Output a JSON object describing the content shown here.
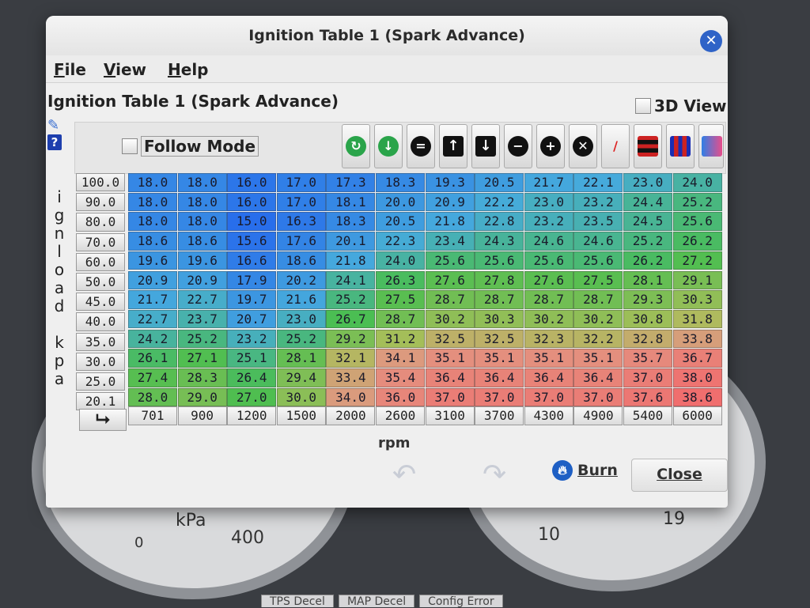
{
  "window": {
    "title": "Ignition Table 1 (Spark Advance)"
  },
  "menu": [
    "File",
    "View",
    "Help"
  ],
  "table_heading": "Ignition Table 1 (Spark Advance)",
  "view3d_label": "3D View",
  "follow_mode_label": "Follow Mode",
  "toolbar_icons": [
    "rotate-up-icon",
    "rotate-down-icon",
    "equals-icon",
    "arrow-up-icon",
    "arrow-down-icon",
    "minus-icon",
    "plus-icon",
    "multiply-icon",
    "pencil-icon",
    "rows-icon",
    "columns-icon",
    "color-gradient-icon"
  ],
  "y_axis": {
    "label": "i g n l o a d   k p a",
    "chars": [
      "i",
      "g",
      "n",
      "l",
      "o",
      "a",
      "d",
      "",
      "k",
      "p",
      "a"
    ],
    "values": [
      "100.0",
      "90.0",
      "80.0",
      "70.0",
      "60.0",
      "50.0",
      "45.0",
      "40.0",
      "35.0",
      "30.0",
      "25.0",
      "20.1"
    ]
  },
  "x_axis": {
    "label": "rpm",
    "values": [
      "701",
      "900",
      "1200",
      "1500",
      "2000",
      "2600",
      "3100",
      "3700",
      "4300",
      "4900",
      "5400",
      "6000"
    ]
  },
  "grid": [
    [
      "18.0",
      "18.0",
      "16.0",
      "17.0",
      "17.3",
      "18.3",
      "19.3",
      "20.5",
      "21.7",
      "22.1",
      "23.0",
      "24.0"
    ],
    [
      "18.0",
      "18.0",
      "16.0",
      "17.0",
      "18.1",
      "20.0",
      "20.9",
      "22.2",
      "23.0",
      "23.2",
      "24.4",
      "25.2"
    ],
    [
      "18.0",
      "18.0",
      "15.0",
      "16.3",
      "18.3",
      "20.5",
      "21.8",
      "22.8",
      "23.2",
      "23.5",
      "24.5",
      "25.6"
    ],
    [
      "18.6",
      "18.6",
      "15.6",
      "17.6",
      "20.1",
      "22.3",
      "23.4",
      "24.3",
      "24.6",
      "24.6",
      "25.2",
      "26.2"
    ],
    [
      "19.6",
      "19.6",
      "16.6",
      "18.6",
      "21.8",
      "24.0",
      "25.6",
      "25.6",
      "25.6",
      "25.6",
      "26.2",
      "27.2"
    ],
    [
      "20.9",
      "20.9",
      "17.9",
      "20.2",
      "24.1",
      "26.3",
      "27.6",
      "27.8",
      "27.6",
      "27.5",
      "28.1",
      "29.1"
    ],
    [
      "21.7",
      "22.7",
      "19.7",
      "21.6",
      "25.2",
      "27.5",
      "28.7",
      "28.7",
      "28.7",
      "28.7",
      "29.3",
      "30.3"
    ],
    [
      "22.7",
      "23.7",
      "20.7",
      "23.0",
      "26.7",
      "28.7",
      "30.2",
      "30.3",
      "30.2",
      "30.2",
      "30.8",
      "31.8"
    ],
    [
      "24.2",
      "25.2",
      "23.2",
      "25.2",
      "29.2",
      "31.2",
      "32.5",
      "32.5",
      "32.3",
      "32.2",
      "32.8",
      "33.8"
    ],
    [
      "26.1",
      "27.1",
      "25.1",
      "28.1",
      "32.1",
      "34.1",
      "35.1",
      "35.1",
      "35.1",
      "35.1",
      "35.7",
      "36.7"
    ],
    [
      "27.4",
      "28.3",
      "26.4",
      "29.4",
      "33.4",
      "35.4",
      "36.4",
      "36.4",
      "36.4",
      "36.4",
      "37.0",
      "38.0"
    ],
    [
      "28.0",
      "29.0",
      "27.0",
      "30.0",
      "34.0",
      "36.0",
      "37.0",
      "37.0",
      "37.0",
      "37.0",
      "37.6",
      "38.6"
    ]
  ],
  "buttons": {
    "burn": "Burn",
    "close": "Close"
  },
  "background": {
    "gauge_left_unit": "kPa",
    "gauge_left_value": "400",
    "gauge_left_zero": "0",
    "gauge_right_value": "10",
    "gauge_right_value2": "19",
    "bottom_tabs": [
      "TPS Decel",
      "MAP Decel",
      "Config Error"
    ]
  },
  "colors": {
    "low": "#2f7fe6",
    "mid": "#48c45a",
    "high": "#f07c78"
  }
}
